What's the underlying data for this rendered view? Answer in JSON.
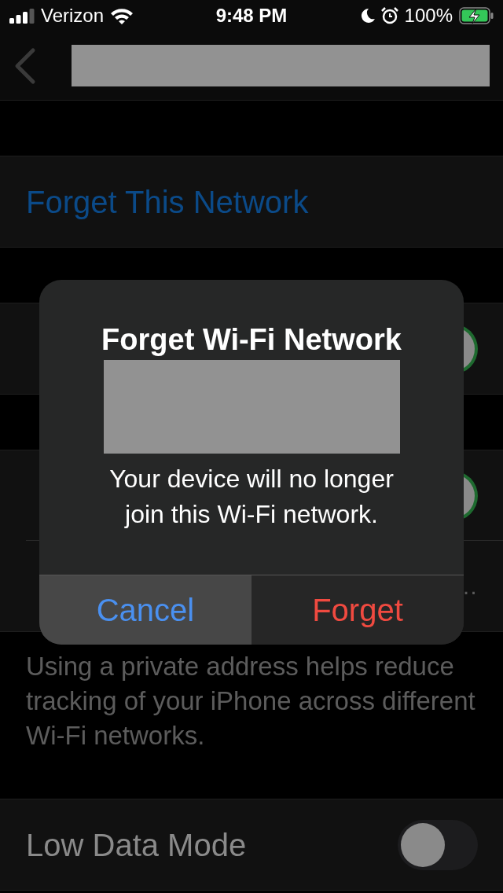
{
  "status_bar": {
    "carrier": "Verizon",
    "time": "9:48 PM",
    "battery": "100%"
  },
  "groups": [
    {
      "rows": [
        {
          "kind": "action",
          "label": "Forget This Network"
        }
      ]
    },
    {
      "rows": [
        {
          "kind": "toggle",
          "on": true
        }
      ]
    },
    {
      "rows": [
        {
          "kind": "toggle",
          "on": true
        },
        {
          "kind": "detail",
          "value": "…"
        }
      ],
      "footer": "Using a private address helps reduce tracking of your iPhone across different Wi-Fi networks."
    },
    {
      "rows": [
        {
          "kind": "toggle",
          "label": "Low Data Mode",
          "on": false
        }
      ]
    }
  ],
  "alert": {
    "title": "Forget Wi-Fi Network",
    "message": "Your device will no longer join this Wi-Fi network.",
    "buttons": [
      {
        "label": "Cancel",
        "kind": "cancel",
        "selected": true
      },
      {
        "label": "Forget",
        "kind": "destructive",
        "selected": false
      }
    ]
  }
}
